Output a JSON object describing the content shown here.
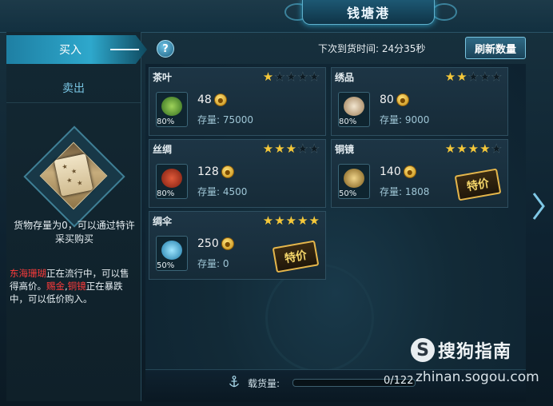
{
  "window": {
    "title": "钱塘港"
  },
  "tabs": {
    "buy_label": "买入",
    "sell_label": "卖出"
  },
  "header": {
    "help_glyph": "?",
    "next_arrival": "下次到货时间: 24分35秒",
    "refresh_label": "刷新数量"
  },
  "sidebar": {
    "info": "货物存量为0，可以通过特许采买购买",
    "market_red1": "东海珊瑚",
    "market_text1": "正在流行中，可以售得高价。",
    "market_red2": "赐金",
    "market_sep": ",",
    "market_red3": "铜镜",
    "market_text2": "正在暴跌中，可以低价购入。"
  },
  "goods": [
    {
      "name": "茶叶",
      "stars": 1,
      "price": "48",
      "stock_label": "存量:",
      "stock": "75000",
      "percent": "80%",
      "special": false,
      "icon": "tea-leaf-icon"
    },
    {
      "name": "绣品",
      "stars": 2,
      "price": "80",
      "stock_label": "存量:",
      "stock": "9000",
      "percent": "80%",
      "special": false,
      "icon": "embroidery-icon"
    },
    {
      "name": "丝绸",
      "stars": 3,
      "price": "128",
      "stock_label": "存量:",
      "stock": "4500",
      "percent": "80%",
      "special": false,
      "icon": "silk-icon"
    },
    {
      "name": "铜镜",
      "stars": 4,
      "price": "140",
      "stock_label": "存量:",
      "stock": "1808",
      "percent": "50%",
      "special": true,
      "special_label": "特价",
      "icon": "bronze-mirror-icon"
    },
    {
      "name": "绸伞",
      "stars": 5,
      "price": "250",
      "stock_label": "存量:",
      "stock": "0",
      "percent": "50%",
      "special": true,
      "special_label": "特价",
      "icon": "umbrella-icon"
    }
  ],
  "cargo": {
    "label": "载货量:",
    "value": "0/122",
    "fraction": 0.0
  },
  "watermark": {
    "logo_glyph": "S",
    "brand": "搜狗指南",
    "url": "zhinan.sogou.com"
  },
  "icons": {
    "help": "help-icon",
    "next_page": "chevron-right-icon",
    "anchor": "anchor-icon",
    "coin": "coin-icon",
    "scroll": "scroll-icon"
  },
  "colors": {
    "accent": "#2ea8cc",
    "star": "#f5c83a",
    "warning": "#ff3b3b"
  }
}
